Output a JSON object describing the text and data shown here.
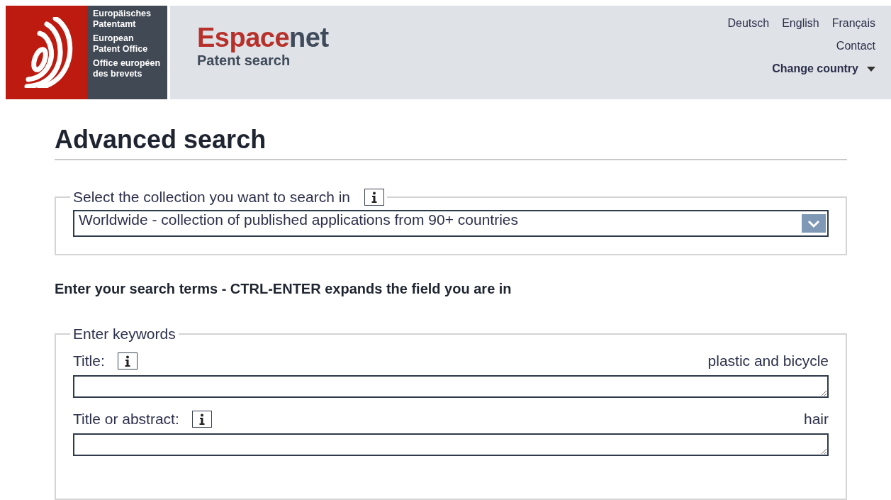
{
  "header": {
    "org_lines": [
      [
        "Europäisches",
        "Patentamt"
      ],
      [
        "European",
        "Patent Office"
      ],
      [
        "Office européen",
        "des brevets"
      ]
    ],
    "brand": {
      "highlight": "Espace",
      "rest": "net"
    },
    "subtitle": "Patent search",
    "languages": [
      {
        "label": "Deutsch"
      },
      {
        "label": "English"
      },
      {
        "label": "Français"
      }
    ],
    "contact": "Contact",
    "country": "Change country"
  },
  "page_title": "Advanced search",
  "collection": {
    "legend": "Select the collection you want to search in",
    "value": "Worldwide - collection of published applications from 90+ countries"
  },
  "instructions": "Enter your search terms - CTRL-ENTER expands the field you are in",
  "keywords": {
    "legend": "Enter keywords",
    "fields": [
      {
        "label": "Title:",
        "example": "plastic and bicycle"
      },
      {
        "label": "Title or abstract:",
        "example": "hair"
      }
    ]
  }
}
